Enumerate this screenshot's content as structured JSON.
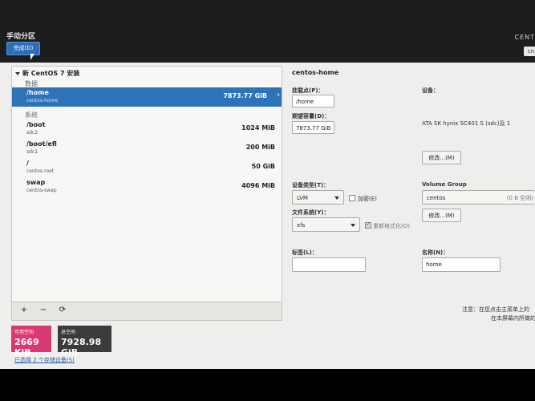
{
  "header": {
    "title": "手动分区",
    "done_label": "完成(D)",
    "brand": "CENT",
    "keyboard": "cn"
  },
  "left": {
    "installation": "新 CentOS 7 安装",
    "data_section": "数据",
    "system_section": "系统",
    "data_mounts": [
      {
        "mount": "/home",
        "device": "centos-home",
        "size": "7873.77 GiB"
      }
    ],
    "system_mounts": [
      {
        "mount": "/boot",
        "device": "sdc2",
        "size": "1024 MiB"
      },
      {
        "mount": "/boot/efi",
        "device": "sdc1",
        "size": "200 MiB"
      },
      {
        "mount": "/",
        "device": "centos-root",
        "size": "50 GiB"
      },
      {
        "mount": "swap",
        "device": "centos-swap",
        "size": "4096 MiB"
      }
    ],
    "toolbar": {
      "add": "+",
      "remove": "−",
      "refresh": "⟳"
    },
    "available": {
      "label": "可用空间",
      "value": "2669 KiB"
    },
    "total": {
      "label": "总空间",
      "value": "7928.98 GiB"
    },
    "storage_link": "已选择 2 个存储设备(S)"
  },
  "right": {
    "title": "centos-home",
    "mount_point_label": "挂载点(P)：",
    "mount_point_value": "/home",
    "capacity_label": "期望容量(D)：",
    "capacity_value": "7873.77 GiB",
    "device_label": "设备：",
    "device_value": "ATA SK hynix SC401 S (sdc)及 1",
    "modify_label": "修改...(M)",
    "device_type_label": "设备类型(T)：",
    "device_type_value": "LVM",
    "encrypt_label": "加密(E)",
    "fs_label": "文件系统(Y)：",
    "fs_value": "xfs",
    "reformat_label": "重新格式化(O)",
    "vg_label": "Volume Group",
    "vg_value": "centos",
    "vg_free": "(0 B 空闲)",
    "vg_modify_label": "修改...(M)",
    "tag_label": "标签(L)：",
    "tag_value": "",
    "name_label": "名称(N)：",
    "name_value": "home",
    "note_line1": "注意：在您点击主菜单上的",
    "note_line2": "在本屏幕内所做的"
  }
}
